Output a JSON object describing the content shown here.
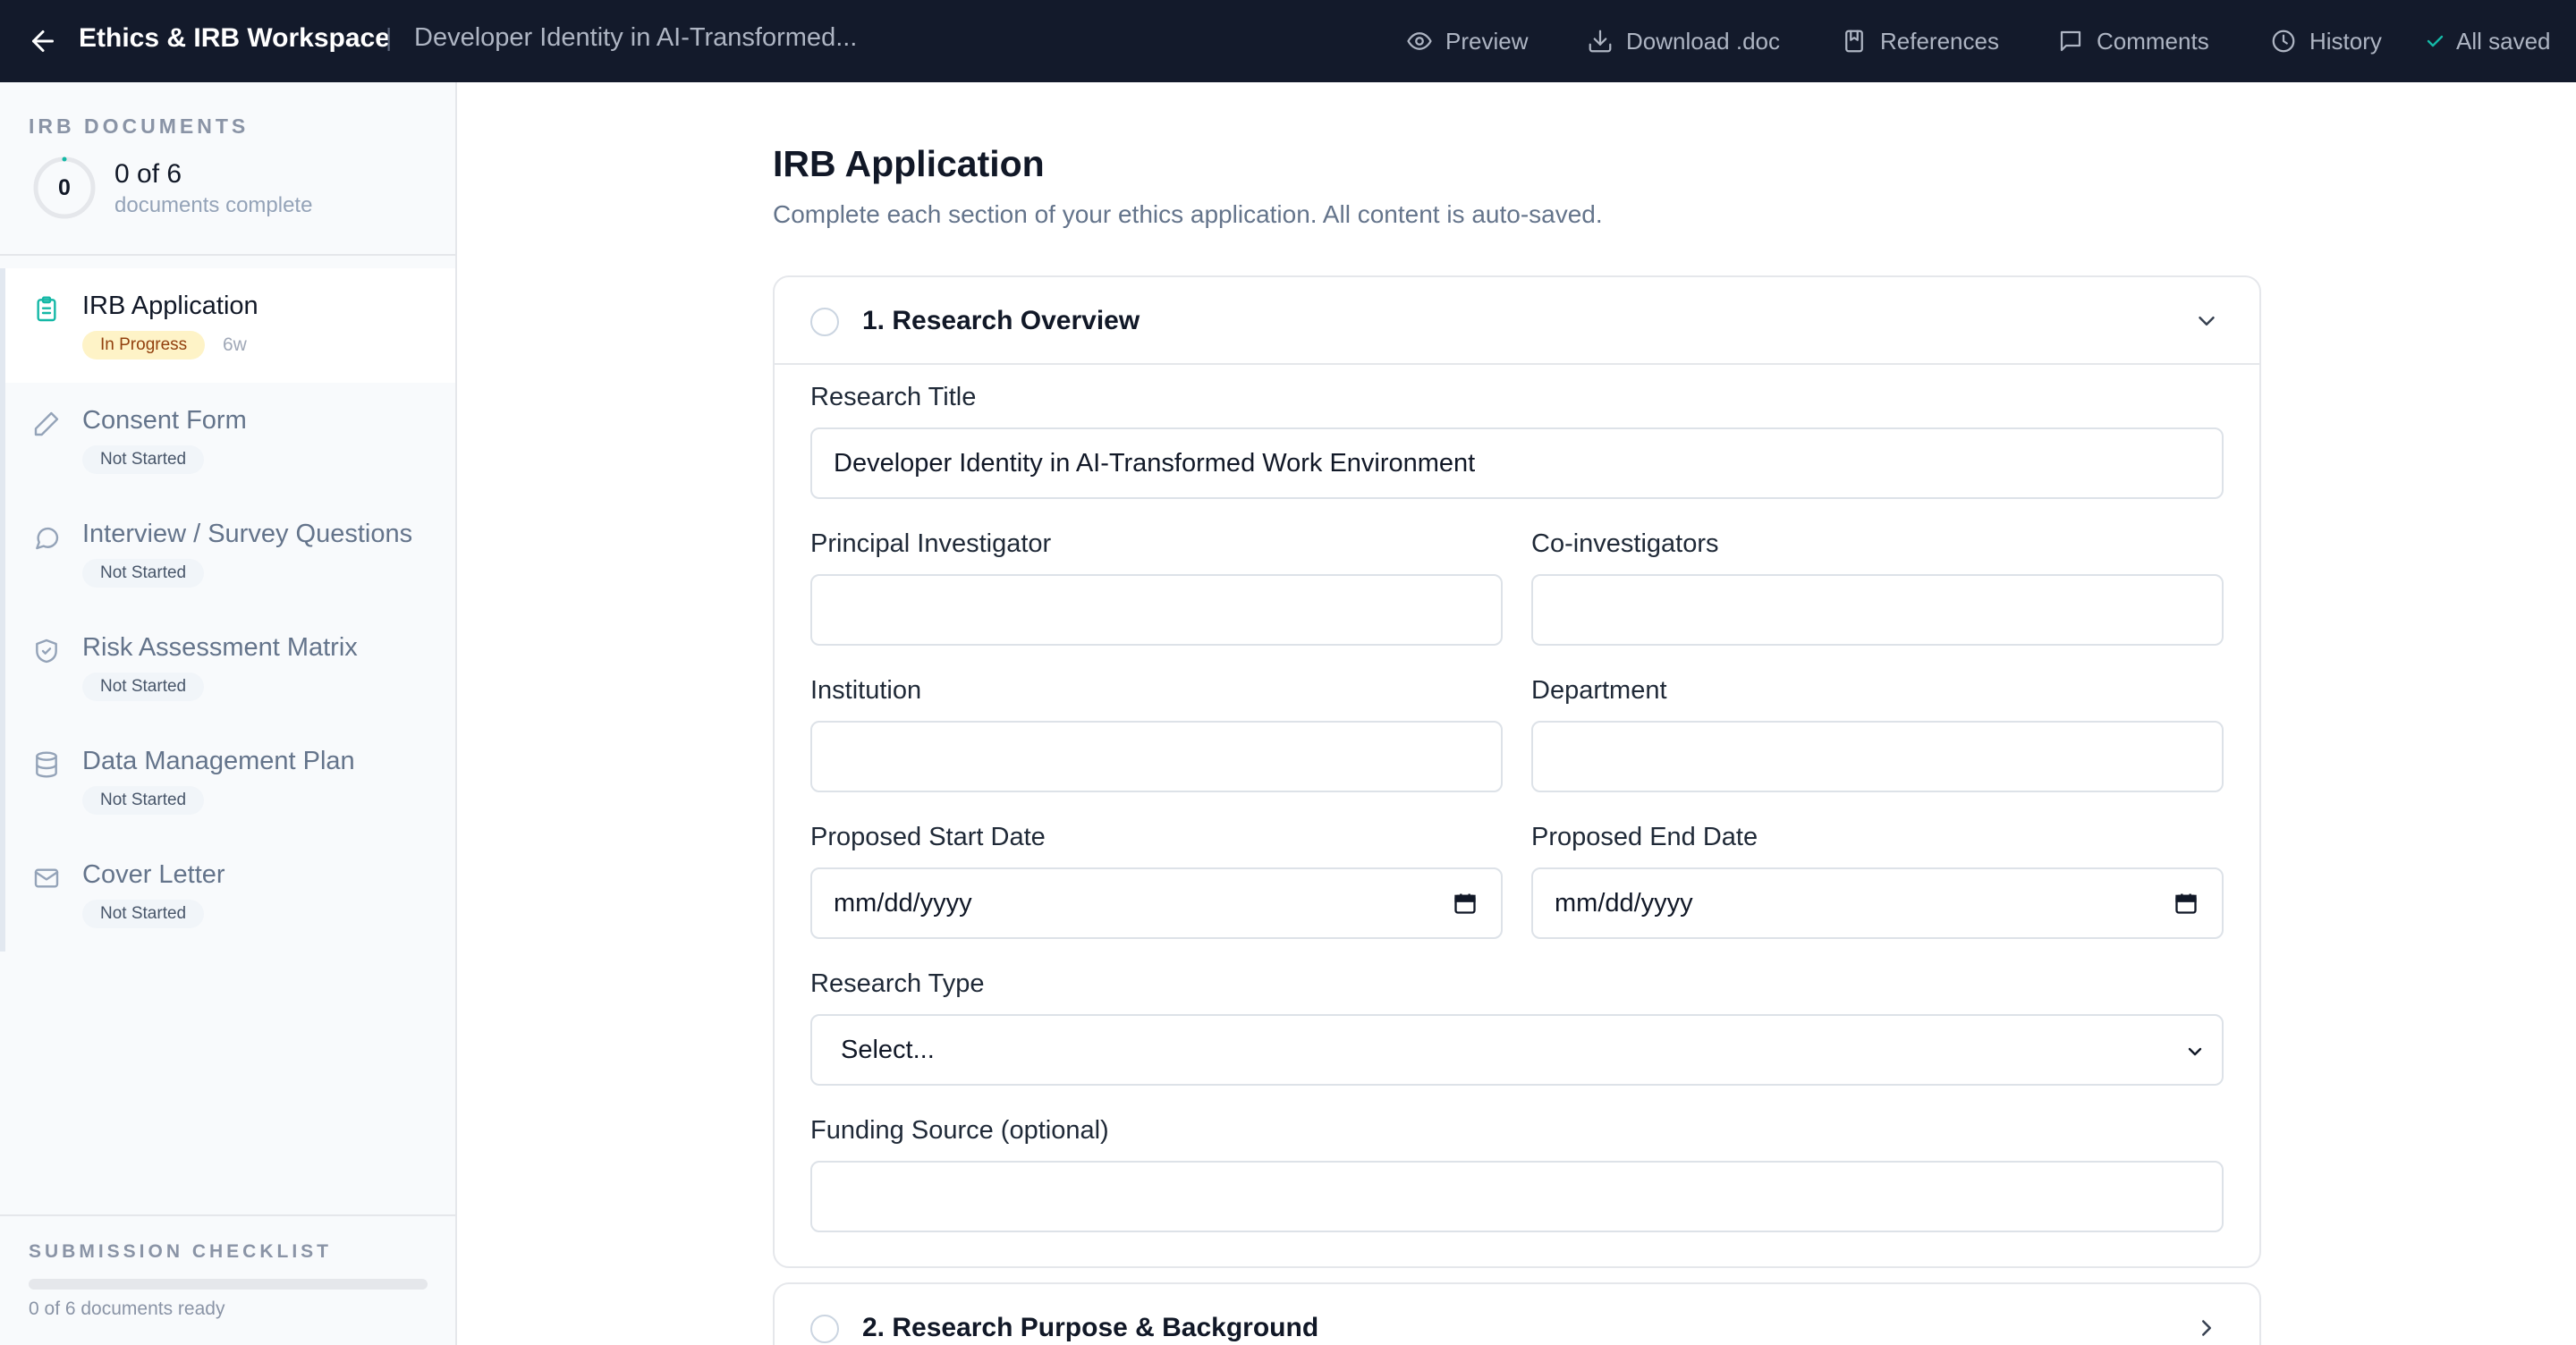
{
  "topbar": {
    "app_title": "Ethics & IRB Workspace",
    "separator": "|",
    "doc_title": "Developer Identity in AI-Transformed...",
    "actions": [
      {
        "label": "Preview",
        "icon": "eye-icon"
      },
      {
        "label": "Download .doc",
        "icon": "download-icon"
      },
      {
        "label": "References",
        "icon": "bookmark-icon"
      },
      {
        "label": "Comments",
        "icon": "comment-icon"
      },
      {
        "label": "History",
        "icon": "clock-icon"
      }
    ],
    "saved_status": "All saved"
  },
  "sidebar": {
    "heading": "IRB DOCUMENTS",
    "progress_value": "0",
    "progress_count": "0 of 6",
    "progress_label": "documents complete",
    "documents": [
      {
        "name": "IRB Application",
        "status": "In Progress",
        "age": "6w",
        "icon": "clipboard-icon",
        "active": true
      },
      {
        "name": "Consent Form",
        "status": "Not Started",
        "icon": "pencil-icon"
      },
      {
        "name": "Interview / Survey Questions",
        "status": "Not Started",
        "icon": "chat-bubble-icon"
      },
      {
        "name": "Risk Assessment Matrix",
        "status": "Not Started",
        "icon": "shield-icon"
      },
      {
        "name": "Data Management Plan",
        "status": "Not Started",
        "icon": "database-icon"
      },
      {
        "name": "Cover Letter",
        "status": "Not Started",
        "icon": "mail-icon"
      }
    ],
    "checklist": {
      "heading": "SUBMISSION CHECKLIST",
      "progress_fraction": 0,
      "label": "0 of 6 documents ready"
    }
  },
  "main": {
    "title": "IRB Application",
    "subtitle": "Complete each section of your ethics application. All content is auto-saved.",
    "sections": [
      {
        "title": "1. Research Overview",
        "expanded": true,
        "fields": {
          "research_title": {
            "label": "Research Title",
            "value": "Developer Identity in AI-Transformed Work Environment"
          },
          "principal_investigator": {
            "label": "Principal Investigator",
            "value": ""
          },
          "co_investigators": {
            "label": "Co-investigators",
            "value": ""
          },
          "institution": {
            "label": "Institution",
            "value": ""
          },
          "department": {
            "label": "Department",
            "value": ""
          },
          "start_date": {
            "label": "Proposed Start Date",
            "value": "mm/dd/yyyy"
          },
          "end_date": {
            "label": "Proposed End Date",
            "value": "mm/dd/yyyy"
          },
          "research_type": {
            "label": "Research Type",
            "value": "Select..."
          },
          "funding_source": {
            "label": "Funding Source (optional)",
            "value": ""
          }
        }
      },
      {
        "title": "2. Research Purpose & Background",
        "expanded": false
      }
    ]
  },
  "colors": {
    "topbar_bg": "#131a2b",
    "accent": "#14b8a6",
    "in_progress_badge_bg": "#fef3c7",
    "in_progress_badge_text": "#92400e"
  }
}
